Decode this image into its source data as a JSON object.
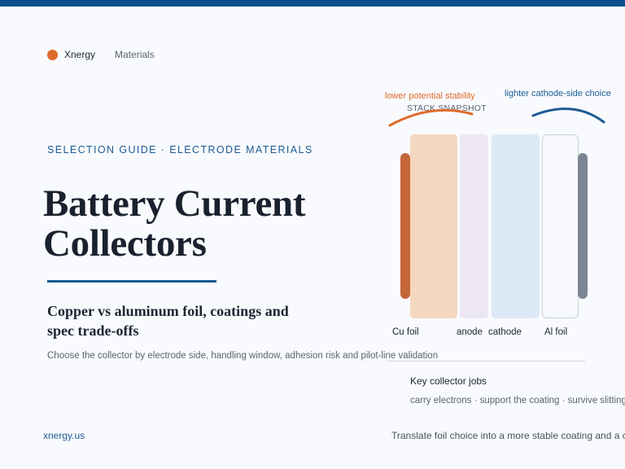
{
  "brand": {
    "name": "Xnergy",
    "nav": "Materials"
  },
  "hero": {
    "eyebrow": "SELECTION GUIDE · ELECTRODE MATERIALS",
    "title": "Battery Current Collectors",
    "subtitle": "Copper vs aluminum foil, coatings and spec trade-offs",
    "description": "Choose the collector by electrode side, handling window, adhesion risk and pilot-line validation"
  },
  "diagram": {
    "heading": "STACK SNAPSHOT",
    "annotations": {
      "left": "lower potential stability",
      "right": "lighter cathode-side choice"
    },
    "labels": [
      "Cu foil",
      "anode",
      "cathode",
      "Al foil"
    ]
  },
  "jobs": {
    "title": "Key collector jobs",
    "list": "carry electrons · support the coating · survive slitting"
  },
  "footer": {
    "url": "xnergy.us",
    "note": "Translate foil choice into a more stable coating and a cle"
  },
  "colors": {
    "accent_blue": "#1d5a93",
    "accent_orange": "#e06a2a",
    "copper": "#c4663a",
    "aluminum": "#7c8594"
  }
}
